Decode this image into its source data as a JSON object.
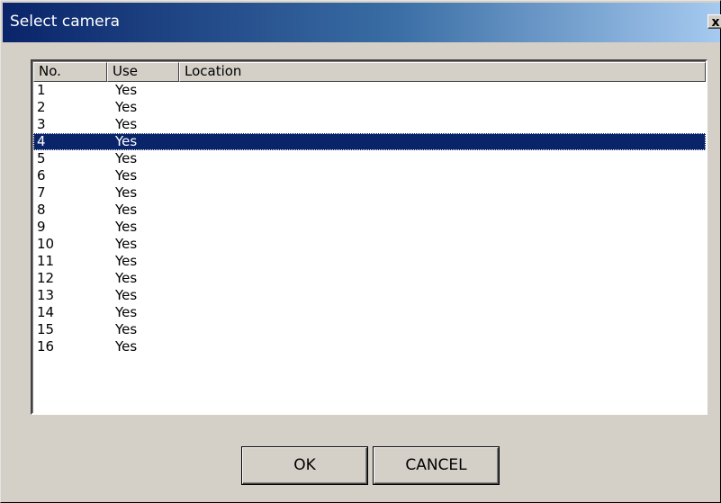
{
  "window": {
    "title": "Select camera",
    "close_label": "x"
  },
  "listview": {
    "columns": [
      "No.",
      "Use",
      "Location"
    ],
    "rows": [
      {
        "no": "1",
        "use": "Yes",
        "location": ""
      },
      {
        "no": "2",
        "use": "Yes",
        "location": ""
      },
      {
        "no": "3",
        "use": "Yes",
        "location": ""
      },
      {
        "no": "4",
        "use": "Yes",
        "location": ""
      },
      {
        "no": "5",
        "use": "Yes",
        "location": ""
      },
      {
        "no": "6",
        "use": "Yes",
        "location": ""
      },
      {
        "no": "7",
        "use": "Yes",
        "location": ""
      },
      {
        "no": "8",
        "use": "Yes",
        "location": ""
      },
      {
        "no": "9",
        "use": "Yes",
        "location": ""
      },
      {
        "no": "10",
        "use": "Yes",
        "location": ""
      },
      {
        "no": "11",
        "use": "Yes",
        "location": ""
      },
      {
        "no": "12",
        "use": "Yes",
        "location": ""
      },
      {
        "no": "13",
        "use": "Yes",
        "location": ""
      },
      {
        "no": "14",
        "use": "Yes",
        "location": ""
      },
      {
        "no": "15",
        "use": "Yes",
        "location": ""
      },
      {
        "no": "16",
        "use": "Yes",
        "location": ""
      }
    ],
    "selected_row": "4"
  },
  "buttons": {
    "ok_label": "OK",
    "cancel_label": "CANCEL"
  },
  "colors": {
    "titlebar_start": "#0a246a",
    "titlebar_end": "#a6caf0",
    "selection": "#0a246a",
    "dialog_face": "#d4d0c8"
  }
}
